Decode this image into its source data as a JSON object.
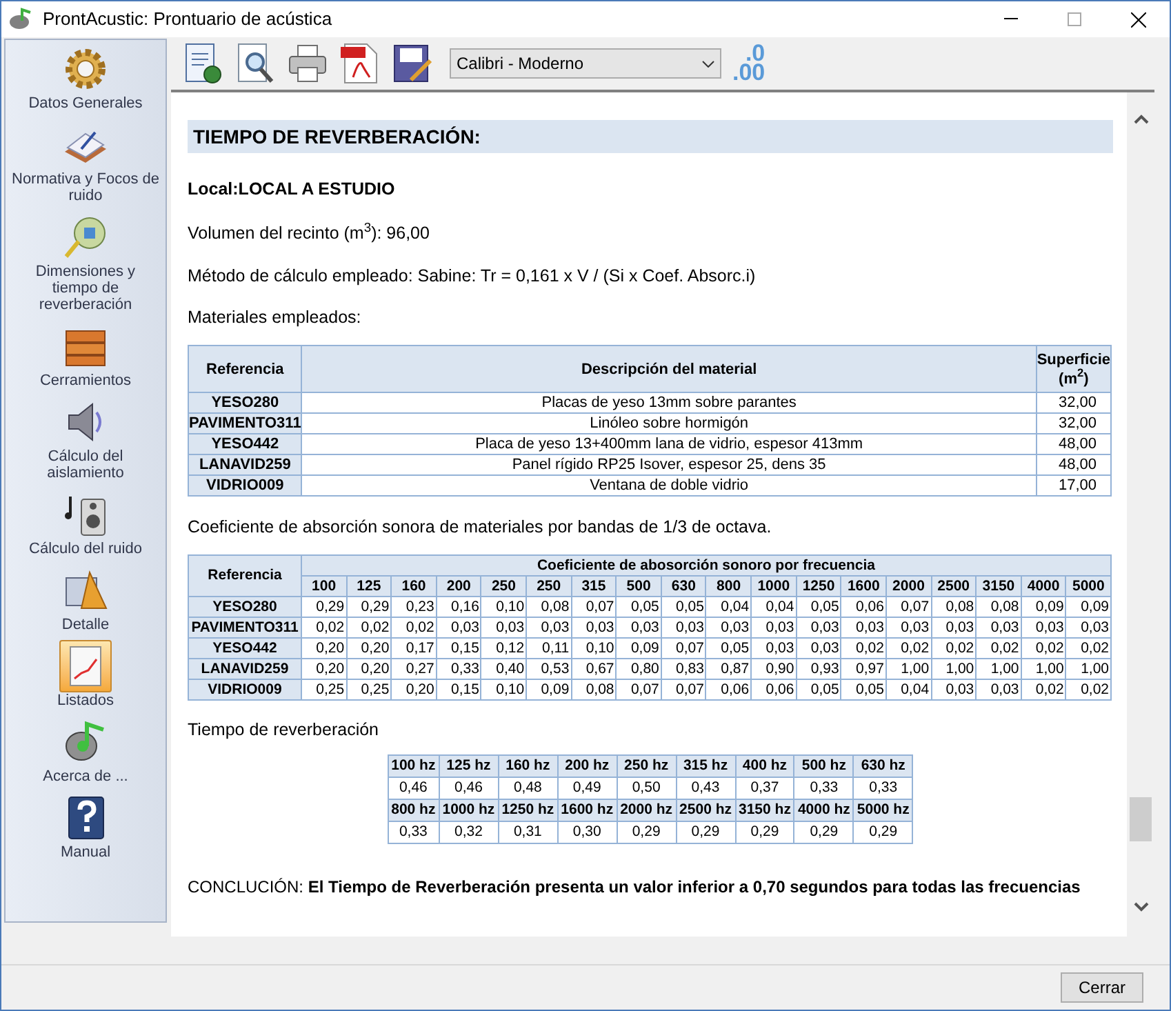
{
  "window": {
    "title": "ProntAcustic: Prontuario de acústica"
  },
  "sidebar": {
    "items": [
      {
        "label": "Datos Generales",
        "selected": false
      },
      {
        "label": "Normativa y Focos de ruido",
        "selected": false
      },
      {
        "label": "Dimensiones y tiempo de reverberación",
        "selected": false
      },
      {
        "label": "Cerramientos",
        "selected": false
      },
      {
        "label": "Cálculo del aislamiento",
        "selected": false
      },
      {
        "label": "Cálculo del ruido",
        "selected": false
      },
      {
        "label": "Detalle",
        "selected": false
      },
      {
        "label": "Listados",
        "selected": true
      },
      {
        "label": "Acerca de ...",
        "selected": false
      },
      {
        "label": "Manual",
        "selected": false
      }
    ]
  },
  "toolbar": {
    "font_select": {
      "value": "Calibri - Moderno"
    },
    "decimals": {
      "top": ".0",
      "bottom": ".00"
    }
  },
  "report": {
    "heading": "TIEMPO DE REVERBERACIÓN:",
    "local": "Local:LOCAL A ESTUDIO",
    "volume": "Volumen del recinto (m$^{3}$): 96,00",
    "method": "Método de cálculo empleado: Sabine: Tr = 0,161 x V / (Si x Coef. Absorc.i)",
    "materials_label": "Materiales empleados:",
    "materials_table": {
      "columns": [
        "Referencia",
        "Descripción del material",
        "Superficie (m$^{2}$)"
      ],
      "rows": [
        [
          "YESO280",
          "Placas de yeso 13mm sobre parantes",
          "32,00"
        ],
        [
          "PAVIMENTO311",
          "Linóleo sobre hormigón",
          "32,00"
        ],
        [
          "YESO442",
          "Placa de yeso 13+400mm lana de vidrio, espesor 413mm",
          "48,00"
        ],
        [
          "LANAVID259",
          "Panel rígido RP25 Isover, espesor 25, dens 35",
          "48,00"
        ],
        [
          "VIDRIO009",
          "Ventana de doble vidrio",
          "17,00"
        ]
      ]
    },
    "absorption_label": "Coeficiente de absorción sonora de materiales por bandas de 1/3 de octava.",
    "absorption_table": {
      "ref_header": "Referencia",
      "group_header": "Coeficiente de abosorción sonoro por frecuencia",
      "frequencies": [
        "100",
        "125",
        "160",
        "200",
        "250",
        "250",
        "315",
        "500",
        "630",
        "800",
        "1000",
        "1250",
        "1600",
        "2000",
        "2500",
        "3150",
        "4000",
        "5000"
      ],
      "rows": [
        {
          "ref": "YESO280",
          "values": [
            "0,29",
            "0,29",
            "0,23",
            "0,16",
            "0,10",
            "0,08",
            "0,07",
            "0,05",
            "0,05",
            "0,04",
            "0,04",
            "0,05",
            "0,06",
            "0,07",
            "0,08",
            "0,08",
            "0,09",
            "0,09"
          ]
        },
        {
          "ref": "PAVIMENTO311",
          "values": [
            "0,02",
            "0,02",
            "0,02",
            "0,03",
            "0,03",
            "0,03",
            "0,03",
            "0,03",
            "0,03",
            "0,03",
            "0,03",
            "0,03",
            "0,03",
            "0,03",
            "0,03",
            "0,03",
            "0,03",
            "0,03"
          ]
        },
        {
          "ref": "YESO442",
          "values": [
            "0,20",
            "0,20",
            "0,17",
            "0,15",
            "0,12",
            "0,11",
            "0,10",
            "0,09",
            "0,07",
            "0,05",
            "0,03",
            "0,03",
            "0,02",
            "0,02",
            "0,02",
            "0,02",
            "0,02",
            "0,02"
          ]
        },
        {
          "ref": "LANAVID259",
          "values": [
            "0,20",
            "0,20",
            "0,27",
            "0,33",
            "0,40",
            "0,53",
            "0,67",
            "0,80",
            "0,83",
            "0,87",
            "0,90",
            "0,93",
            "0,97",
            "1,00",
            "1,00",
            "1,00",
            "1,00",
            "1,00"
          ]
        },
        {
          "ref": "VIDRIO009",
          "values": [
            "0,25",
            "0,25",
            "0,20",
            "0,15",
            "0,10",
            "0,09",
            "0,08",
            "0,07",
            "0,07",
            "0,06",
            "0,06",
            "0,05",
            "0,05",
            "0,04",
            "0,03",
            "0,03",
            "0,02",
            "0,02"
          ]
        }
      ]
    },
    "reverb_label": "Tiempo de reverberación",
    "reverb_table": [
      {
        "frequencies": [
          "100 hz",
          "125 hz",
          "160 hz",
          "200 hz",
          "250 hz",
          "315 hz",
          "400 hz",
          "500 hz",
          "630 hz"
        ],
        "values": [
          "0,46",
          "0,46",
          "0,48",
          "0,49",
          "0,50",
          "0,43",
          "0,37",
          "0,33",
          "0,33"
        ]
      },
      {
        "frequencies": [
          "800 hz",
          "1000 hz",
          "1250 hz",
          "1600 hz",
          "2000 hz",
          "2500 hz",
          "3150 hz",
          "4000 hz",
          "5000 hz"
        ],
        "values": [
          "0,33",
          "0,32",
          "0,31",
          "0,30",
          "0,29",
          "0,29",
          "0,29",
          "0,29",
          "0,29"
        ]
      }
    ],
    "conclusion": "CONCLUCIÓN: **El Tiempo de Reverberación presenta un valor inferior a 0,70 segundos para todas las frecuencias**"
  },
  "buttons": {
    "close": "Cerrar"
  }
}
